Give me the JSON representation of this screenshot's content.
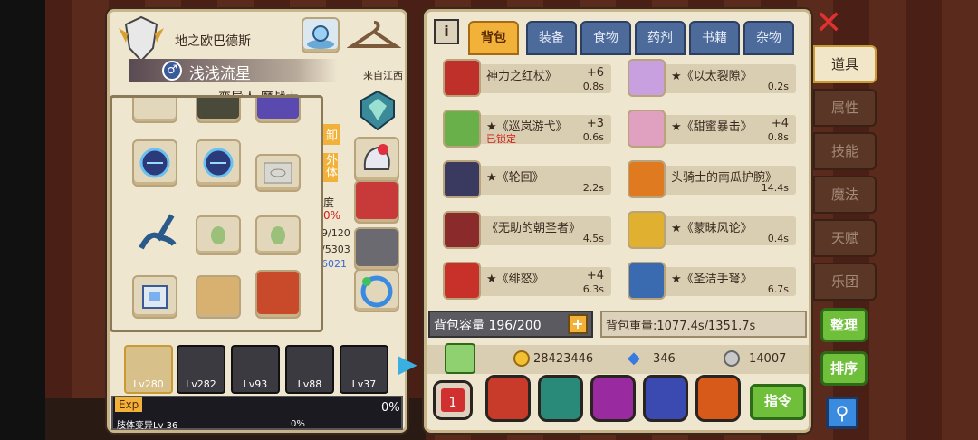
{
  "colors": {
    "accent": "#f2b23a",
    "tab_blue": "#4c6a9a",
    "lock_red": "#d0201a",
    "green": "#6fbf3a"
  },
  "character": {
    "guild": "地之欧巴德斯",
    "name": "浅浅流星",
    "origin": "来自江西",
    "subtitle": "变异人 魔战士",
    "stats_partial": [
      "卸",
      "外",
      "体",
      "度",
      "0%",
      "9/120",
      "/5303",
      "6021"
    ]
  },
  "tabs": [
    "背包",
    "装备",
    "食物",
    "药剂",
    "书籍",
    "杂物"
  ],
  "side_tabs": [
    "道具",
    "属性",
    "技能",
    "魔法",
    "天赋",
    "乐团"
  ],
  "items": [
    {
      "name": "神力之红杖》",
      "qty": "+6",
      "time": "0.8s",
      "locked": ""
    },
    {
      "name": "★《以太裂隙》",
      "qty": "",
      "time": "0.2s",
      "locked": ""
    },
    {
      "name": "★《巡岚游弋》",
      "qty": "+3",
      "time": "0.6s",
      "locked": "已锁定"
    },
    {
      "name": "★《甜蜜暴击》",
      "qty": "+4",
      "time": "0.8s",
      "locked": ""
    },
    {
      "name": "★《轮回》",
      "qty": "",
      "time": "2.2s",
      "locked": ""
    },
    {
      "name": "头骑士的南瓜护腕》",
      "qty": "",
      "time": "14.4s",
      "locked": ""
    },
    {
      "name": "《无助的朝圣者》",
      "qty": "",
      "time": "4.5s",
      "locked": ""
    },
    {
      "name": "★《蒙昧风论》",
      "qty": "",
      "time": "0.4s",
      "locked": ""
    },
    {
      "name": "★《绯怒》",
      "qty": "+4",
      "time": "6.3s",
      "locked": ""
    },
    {
      "name": "★《圣洁手弩》",
      "qty": "",
      "time": "6.7s",
      "locked": ""
    }
  ],
  "capacity": "背包容量 196/200",
  "weight": "背包重量:1077.4s/1351.7s",
  "currency": {
    "gold": "28423446",
    "diamond": "346",
    "silver": "14007"
  },
  "heroes": [
    "Lv280",
    "Lv282",
    "Lv93",
    "Lv88",
    "Lv37"
  ],
  "exp": {
    "label": "Exp",
    "percent": "0%",
    "sub_label": "肢体变异Lv 36",
    "sub_percent": "0%"
  },
  "buttons": {
    "organize": "整理",
    "sort": "排序",
    "command": "指令"
  },
  "icons": [
    "close-icon",
    "info-icon",
    "search-icon",
    "add-icon",
    "gold-coin-icon",
    "diamond-icon",
    "silver-coin-icon",
    "dice-icon"
  ]
}
